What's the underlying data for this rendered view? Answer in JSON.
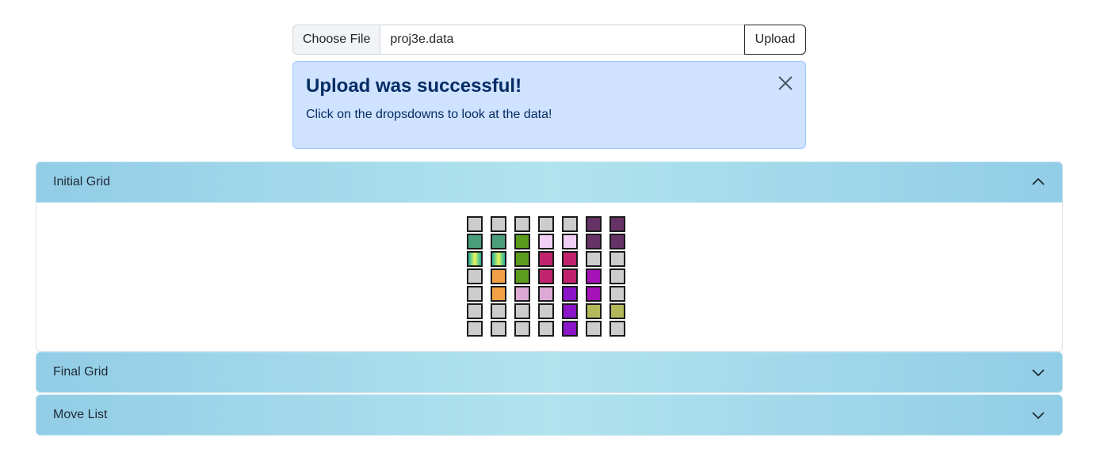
{
  "upload": {
    "choose_label": "Choose File",
    "file_name": "proj3e.data",
    "upload_label": "Upload"
  },
  "alert": {
    "heading": "Upload was successful!",
    "text": "Click on the dropsdowns to look at the data!",
    "close_icon": "close-icon"
  },
  "accordion": [
    {
      "title": "Initial Grid",
      "expanded": true,
      "icon": "chevron-up-icon"
    },
    {
      "title": "Final Grid",
      "expanded": false,
      "icon": "chevron-down-icon"
    },
    {
      "title": "Move List",
      "expanded": false,
      "icon": "chevron-down-icon"
    }
  ],
  "grid": {
    "rows": [
      [
        "#cccccc",
        "#cccccc",
        "#cccccc",
        "#cccccc",
        "#cccccc",
        "#663366",
        "#663366"
      ],
      [
        "#4a9e7c",
        "#4a9e7c",
        "#5b9c1e",
        "#f2d0f5",
        "#f2d0f5",
        "#663366",
        "#663366"
      ],
      [
        "rainbow",
        "rainbow",
        "#5b9c1e",
        "#c0246e",
        "#c0246e",
        "#cccccc",
        "#cccccc"
      ],
      [
        "#cccccc",
        "#f2a045",
        "#5b9c1e",
        "#c0246e",
        "#c0246e",
        "#a512b8",
        "#cccccc"
      ],
      [
        "#cccccc",
        "#f2a045",
        "#dba9d4",
        "#dba9d4",
        "#8a16c8",
        "#a512b8",
        "#cccccc"
      ],
      [
        "#cccccc",
        "#cccccc",
        "#cccccc",
        "#cccccc",
        "#8a16c8",
        "#b3b85a",
        "#b3b85a"
      ],
      [
        "#cccccc",
        "#cccccc",
        "#cccccc",
        "#cccccc",
        "#8a16c8",
        "#cccccc",
        "#cccccc"
      ]
    ]
  }
}
